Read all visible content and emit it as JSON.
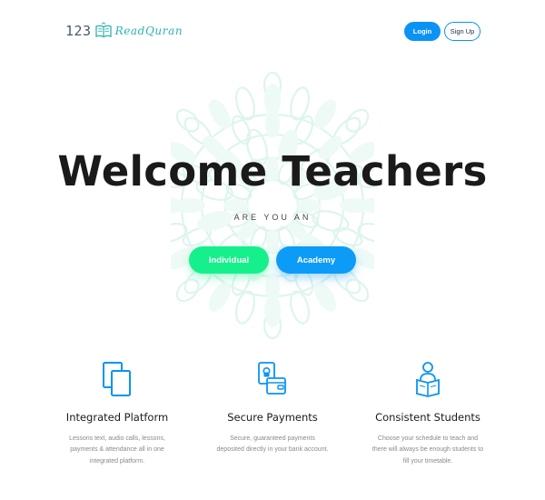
{
  "header": {
    "logo_number": "123",
    "logo_name": "ReadQuran",
    "login_label": "Login",
    "signup_label": "Sign Up"
  },
  "hero": {
    "title": "Welcome Teachers",
    "subtitle": "ARE YOU AN",
    "individual_label": "Individual",
    "academy_label": "Academy"
  },
  "features": [
    {
      "icon": "documents-icon",
      "title": "Integrated Platform",
      "desc_lines": [
        "Lessons text, audio calls, lessons,",
        "payments & attendance all in one",
        "integrated platform."
      ]
    },
    {
      "icon": "lock-wallet-icon",
      "title": "Secure Payments",
      "desc_lines": [
        "Secure, guaranteed payments",
        "deposited directly in your bank account."
      ]
    },
    {
      "icon": "student-reading-icon",
      "title": "Consistent Students",
      "desc_lines": [
        "Choose your schedule to teach and",
        "there will always be enough students to",
        "fill your timetable."
      ]
    }
  ],
  "colors": {
    "primary_blue": "#0a93f5",
    "green": "#15f08c",
    "logo_teal": "#2bb3b0",
    "mandala": "#e6f7f3"
  }
}
